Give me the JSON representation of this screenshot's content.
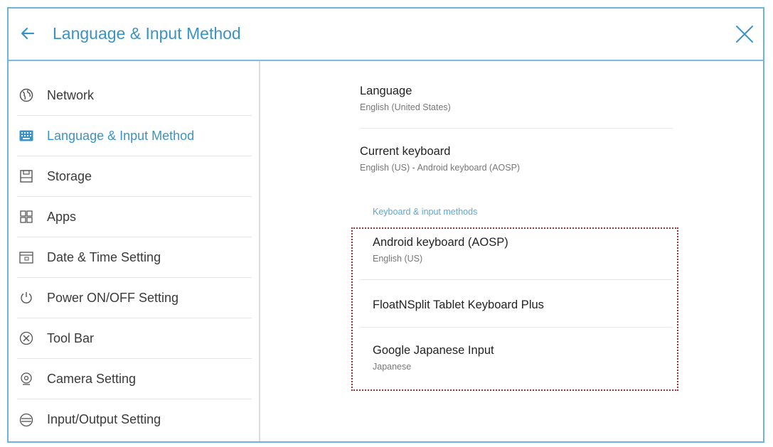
{
  "header": {
    "title": "Language & Input Method"
  },
  "sidebar": {
    "items": [
      {
        "label": "Network",
        "icon": "globe-icon"
      },
      {
        "label": "Language & Input Method",
        "icon": "keyboard-icon",
        "active": true
      },
      {
        "label": "Storage",
        "icon": "storage-icon"
      },
      {
        "label": "Apps",
        "icon": "apps-icon"
      },
      {
        "label": "Date & Time Setting",
        "icon": "calendar-icon"
      },
      {
        "label": "Power ON/OFF Setting",
        "icon": "power-icon"
      },
      {
        "label": "Tool Bar",
        "icon": "tools-icon"
      },
      {
        "label": "Camera Setting",
        "icon": "camera-icon"
      },
      {
        "label": "Input/Output Setting",
        "icon": "input-output-icon"
      }
    ]
  },
  "content": {
    "language": {
      "title": "Language",
      "value": "English (United States)"
    },
    "current_keyboard": {
      "title": "Current keyboard",
      "value": "English (US) - Android keyboard (AOSP)"
    },
    "section_label": "Keyboard & input methods",
    "methods": [
      {
        "title": "Android keyboard (AOSP)",
        "sub": "English (US)"
      },
      {
        "title": "FloatNSplit Tablet Keyboard Plus",
        "sub": ""
      },
      {
        "title": "Google Japanese Input",
        "sub": "Japanese"
      }
    ]
  },
  "colors": {
    "accent": "#3a93c8",
    "frame_border": "#6cb4d8",
    "highlight_box": "#a23030"
  }
}
